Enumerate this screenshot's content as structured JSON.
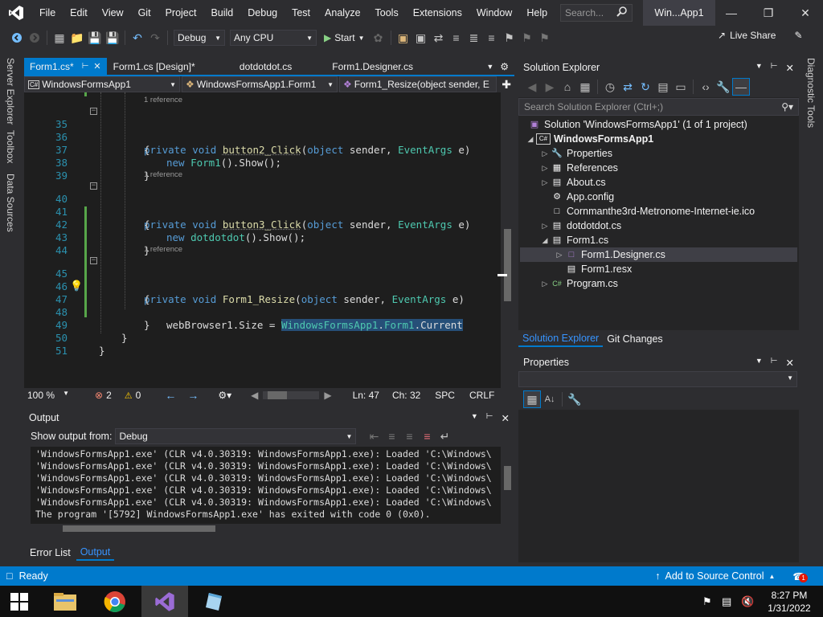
{
  "menu": [
    "File",
    "Edit",
    "View",
    "Git",
    "Project",
    "Build",
    "Debug",
    "Test",
    "Analyze",
    "Tools",
    "Extensions",
    "Window",
    "Help"
  ],
  "search": {
    "placeholder": "Search..."
  },
  "window_title": "Win...App1",
  "toolbar": {
    "config": "Debug",
    "platform": "Any CPU",
    "start_label": "Start",
    "live_share": "Live Share"
  },
  "left_strip": [
    "Server Explorer",
    "Toolbox",
    "Data Sources"
  ],
  "right_strip": [
    "Diagnostic Tools"
  ],
  "doc_tabs": [
    {
      "label": "Form1.cs*",
      "active": true
    },
    {
      "label": "Form1.cs [Design]*",
      "active": false
    },
    {
      "label": "dotdotdot.cs",
      "active": false
    },
    {
      "label": "Form1.Designer.cs",
      "active": false
    }
  ],
  "nav": {
    "project": "WindowsFormsApp1",
    "class": "WindowsFormsApp1.Form1",
    "member": "Form1_Resize(object sender, E"
  },
  "code": {
    "codelens": "1 reference",
    "lines": [
      {
        "n": "35",
        "text": "private void button2_Click(object sender, EventArgs e)"
      },
      {
        "n": "36",
        "text": "{"
      },
      {
        "n": "37",
        "text": "new Form1().Show();"
      },
      {
        "n": "38",
        "text": "}"
      },
      {
        "n": "39",
        "text": ""
      },
      {
        "n": "40",
        "text": "private void button3_Click(object sender, EventArgs e)"
      },
      {
        "n": "41",
        "text": "{"
      },
      {
        "n": "42",
        "text": "new dotdotdot().Show();"
      },
      {
        "n": "43",
        "text": "}"
      },
      {
        "n": "44",
        "text": ""
      },
      {
        "n": "45",
        "text": "private void Form1_Resize(object sender, EventArgs e)"
      },
      {
        "n": "46",
        "text": "{"
      },
      {
        "n": "47",
        "text": "webBrowser1.Size = WindowsFormsApp1.Form1.Current"
      },
      {
        "n": "48",
        "text": "}"
      },
      {
        "n": "49",
        "text": "}"
      },
      {
        "n": "50",
        "text": "}"
      },
      {
        "n": "51",
        "text": ""
      }
    ]
  },
  "editor_status": {
    "zoom": "100 %",
    "errors": "2",
    "warnings": "0",
    "line": "Ln: 47",
    "col": "Ch: 32",
    "spacing": "SPC",
    "eol": "CRLF"
  },
  "output": {
    "title": "Output",
    "show_from_label": "Show output from:",
    "show_from_value": "Debug",
    "lines": [
      "'WindowsFormsApp1.exe' (CLR v4.0.30319: WindowsFormsApp1.exe): Loaded 'C:\\Windows\\",
      "'WindowsFormsApp1.exe' (CLR v4.0.30319: WindowsFormsApp1.exe): Loaded 'C:\\Windows\\",
      "'WindowsFormsApp1.exe' (CLR v4.0.30319: WindowsFormsApp1.exe): Loaded 'C:\\Windows\\",
      "'WindowsFormsApp1.exe' (CLR v4.0.30319: WindowsFormsApp1.exe): Loaded 'C:\\Windows\\",
      "'WindowsFormsApp1.exe' (CLR v4.0.30319: WindowsFormsApp1.exe): Loaded 'C:\\Windows\\",
      "The program '[5792] WindowsFormsApp1.exe' has exited with code 0 (0x0)."
    ]
  },
  "bottom_tabs": [
    "Error List",
    "Output"
  ],
  "solution_explorer": {
    "title": "Solution Explorer",
    "search_placeholder": "Search Solution Explorer (Ctrl+;)",
    "tree": [
      "Solution 'WindowsFormsApp1' (1 of 1 project)",
      "WindowsFormsApp1",
      "Properties",
      "References",
      "About.cs",
      "App.config",
      "Cornmanthe3rd-Metronome-Internet-ie.ico",
      "dotdotdot.cs",
      "Form1.cs",
      "Form1.Designer.cs",
      "Form1.resx",
      "Program.cs"
    ],
    "tabs": [
      "Solution Explorer",
      "Git Changes"
    ]
  },
  "properties": {
    "title": "Properties"
  },
  "statusbar": {
    "ready": "Ready",
    "source_control": "Add to Source Control",
    "notifications": "1"
  },
  "clock": {
    "time": "8:27 PM",
    "date": "1/31/2022"
  },
  "colors": {
    "accent": "#007acc",
    "editor_bg": "#1e1e1e",
    "chrome_bg": "#2d2d30"
  }
}
